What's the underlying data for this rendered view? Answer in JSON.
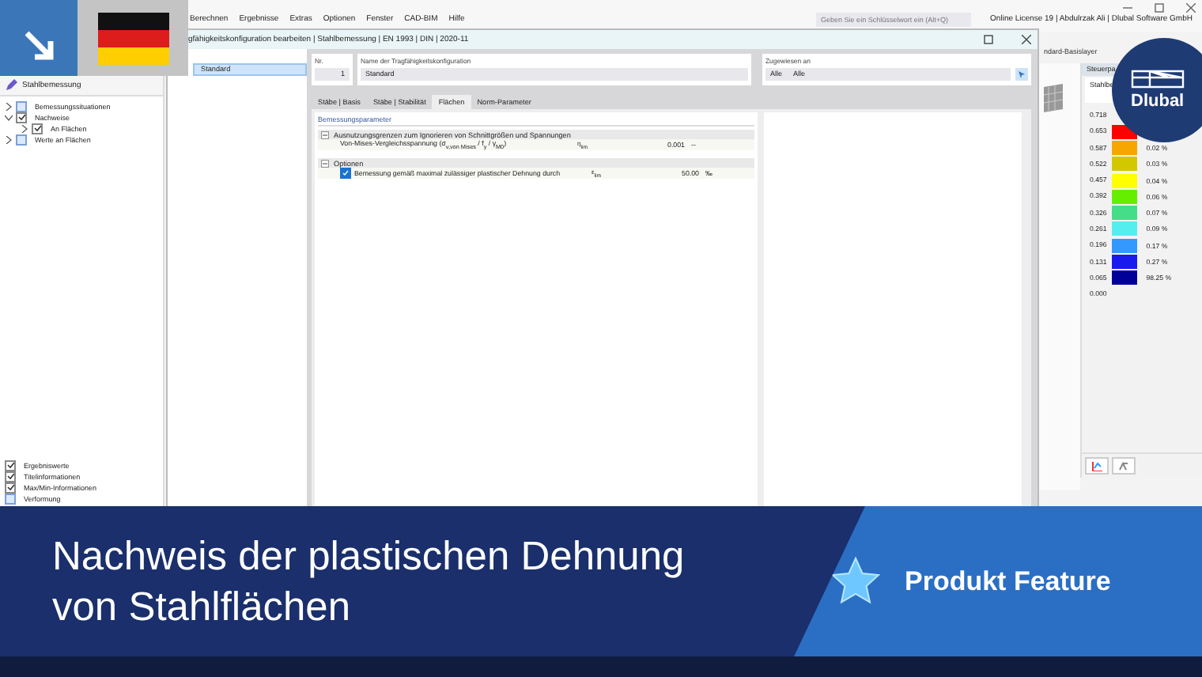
{
  "menu": [
    "Berechnen",
    "Ergebnisse",
    "Extras",
    "Optionen",
    "Fenster",
    "CAD-BIM",
    "Hilfe"
  ],
  "search": {
    "placeholder": "Geben Sie ein Schlüsselwort ein (Alt+Q)"
  },
  "license": "Online License 19 | Abdulrzak Ali | Dlubal Software GmbH",
  "layer_field": "ndard-Basislayer",
  "navigator": {
    "title": "Stahlbemessung",
    "items": [
      {
        "label": "Bemessungssituationen",
        "checked": false,
        "expanded": false
      },
      {
        "label": "Nachweise",
        "checked": true,
        "expanded": true,
        "children": [
          {
            "label": "An Flächen",
            "checked": true,
            "expanded": false
          }
        ]
      },
      {
        "label": "Werte an Flächen",
        "checked": false,
        "expanded": false
      }
    ],
    "bottom_items": [
      {
        "label": "Ergebniswerte",
        "checked": true
      },
      {
        "label": "Titelinformationen",
        "checked": true
      },
      {
        "label": "Max/Min-Informationen",
        "checked": true
      },
      {
        "label": "Verformung",
        "checked": false
      }
    ]
  },
  "dialog": {
    "title": "gfähigkeitskonfiguration bearbeiten | Stahlbemessung | EN 1993 | DIN | 2020-11",
    "list": [
      {
        "label": "Standard",
        "selected": true
      }
    ],
    "no_label": "Nr.",
    "no_value": "1",
    "name_label": "Name der Tragfähigkeitskonfiguration",
    "name_value": "Standard",
    "assign_label": "Zugewiesen an",
    "assign": [
      "Alle",
      "Alle"
    ],
    "tabs": [
      {
        "label": "Stäbe | Basis",
        "selected": false
      },
      {
        "label": "Stäbe | Stabilität",
        "selected": false
      },
      {
        "label": "Flächen",
        "selected": true
      },
      {
        "label": "Norm-Parameter",
        "selected": false
      }
    ],
    "section": "Bemessungsparameter",
    "groups": [
      {
        "title": "Ausnutzungsgrenzen zum Ignorieren von Schnittgrößen und Spannungen",
        "expanded": true,
        "rows": [
          {
            "label": "Von-Mises-Vergleichsspannung (σ$_{v,von Mises}$ / f$_{y}$ / γ$_{M0}$)",
            "symbol": "η$_{lim}$",
            "value": "0.001",
            "unit": "--"
          }
        ]
      },
      {
        "title": "Optionen",
        "expanded": true,
        "rows": [
          {
            "label": "Bemessung gemäß maximal zulässiger plastischer Dehnung durch",
            "checked": true,
            "symbol": "ε$_{lim}$",
            "value": "50.00",
            "unit": "‰"
          }
        ]
      }
    ]
  },
  "legend": {
    "title": "Steuerpa",
    "subtitle": "Stahlbe",
    "values": [
      "0.718",
      "0.653",
      "0.587",
      "0.522",
      "0.457",
      "0.392",
      "0.326",
      "0.261",
      "0.196",
      "0.131",
      "0.065",
      "0.000"
    ],
    "bands": [
      {
        "color": "#ff0000"
      },
      {
        "color": "#f7a600",
        "percent": "0.02 %"
      },
      {
        "color": "#d2c800",
        "percent": "0.03 %"
      },
      {
        "color": "#ffff00",
        "percent": "0.04 %"
      },
      {
        "color": "#66ee00",
        "percent": "0.06 %"
      },
      {
        "color": "#44dd88",
        "percent": "0.07 %"
      },
      {
        "color": "#55eeee",
        "percent": "0.09 %"
      },
      {
        "color": "#3399ff",
        "percent": "0.17 %"
      },
      {
        "color": "#1a1aee",
        "percent": "0.27 %"
      },
      {
        "color": "#000099",
        "percent": "98.25 %"
      }
    ]
  },
  "banner": {
    "title": "Nachweis der plastischen Dehnung von Stahlflächen",
    "tag": "Produkt Feature"
  },
  "logo": {
    "text": "Dlubal"
  }
}
